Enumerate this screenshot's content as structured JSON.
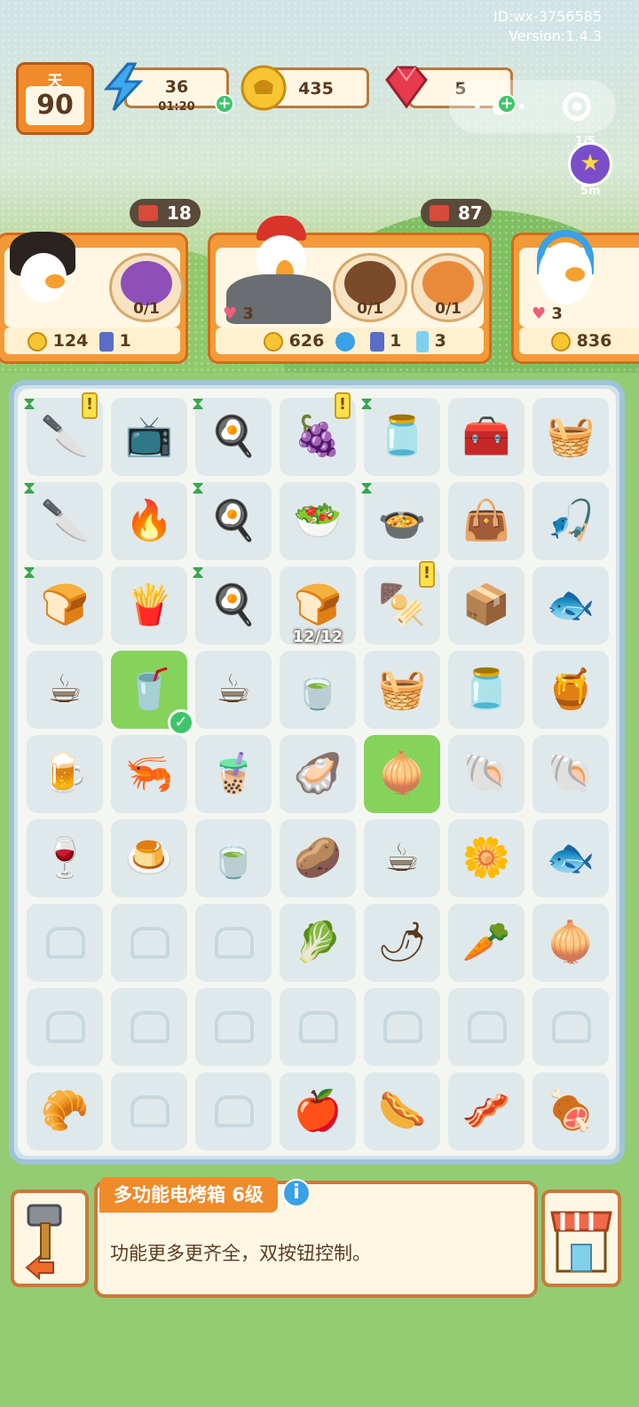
{
  "account": {
    "id_text": "ID:wx-3756585",
    "version_text": "Version:1.4.3"
  },
  "day": {
    "label": "天",
    "value": "90"
  },
  "resources": {
    "energy": {
      "value": "36",
      "timer": "01:20"
    },
    "coins": {
      "value": "435"
    },
    "gems": {
      "value": "5"
    }
  },
  "event": {
    "progress": "1/5",
    "timer": "5m"
  },
  "ticket_badges": [
    "18",
    "87"
  ],
  "customers": [
    {
      "order_label": "0/1",
      "reward_coins": "124",
      "reward_item": "1"
    },
    {
      "hearts": "3",
      "orders": [
        "0/1",
        "0/1"
      ],
      "reward_coins": "626",
      "reward_item": "1",
      "reward_extra": "3"
    },
    {
      "hearts": "3",
      "reward_coins": "836"
    }
  ],
  "board": {
    "rows": [
      [
        "cutting-board-station",
        "microwave",
        "green-stove",
        "fruit-bowl",
        "water-dispenser",
        "lunchbox",
        "fishing-basket"
      ],
      [
        "knife-station",
        "blue-oven",
        "green-stove",
        "veggie-bowl",
        "red-pot",
        "bag",
        "fishing-rod"
      ],
      [
        "pink-oven",
        "fryer",
        "green-stove",
        "toaster",
        "grill",
        "produce-crates",
        "fish-toy"
      ],
      [
        "coffee-cup",
        "takeaway-cup",
        "tea-cup",
        "tea-glass",
        "basket",
        "jam-jar",
        "honey-jar"
      ],
      [
        "beer",
        "shrimp",
        "iced-coffee",
        "oyster",
        "onion",
        "clam",
        "shell"
      ],
      [
        "wine",
        "pudding",
        "tea-bag",
        "potato",
        "coffee-beans",
        "flower",
        "fish"
      ],
      [
        "empty",
        "empty",
        "empty",
        "lettuce",
        "chili",
        "carrot",
        "purple-onion"
      ],
      [
        "empty",
        "empty",
        "empty",
        "empty",
        "empty",
        "empty",
        "empty"
      ],
      [
        "display-case",
        "empty",
        "empty",
        "apple",
        "sausage",
        "bacon",
        "ham"
      ]
    ],
    "selected_count": "12/12"
  },
  "info_panel": {
    "title": "多功能电烤箱 6级",
    "description": "功能更多更齐全，双按钮控制。"
  },
  "colors": {
    "accent": "#f08a2a",
    "grass": "#93cc72",
    "board": "#cfe2ec"
  }
}
